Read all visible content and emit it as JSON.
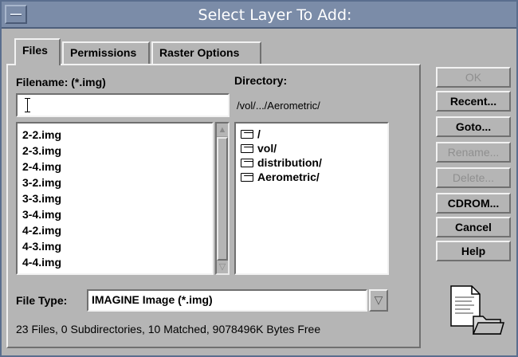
{
  "window": {
    "title": "Select Layer To Add:"
  },
  "tabs": [
    {
      "label": "Files",
      "active": true
    },
    {
      "label": "Permissions",
      "active": false
    },
    {
      "label": "Raster Options",
      "active": false
    }
  ],
  "filename": {
    "label": "Filename: (*.img)",
    "value": ""
  },
  "directory": {
    "label": "Directory:",
    "path": "/vol/.../Aerometric/"
  },
  "files": [
    "2-2.img",
    "2-3.img",
    "2-4.img",
    "3-2.img",
    "3-3.img",
    "3-4.img",
    "4-2.img",
    "4-3.img",
    "4-4.img"
  ],
  "directories": [
    "/",
    "vol/",
    "distribution/",
    "Aerometric/"
  ],
  "file_type": {
    "label": "File Type:",
    "value": "IMAGINE Image (*.img)"
  },
  "status": "23 Files, 0 Subdirectories, 10 Matched, 9078496K Bytes Free",
  "buttons": {
    "ok": "OK",
    "recent": "Recent...",
    "goto": "Goto...",
    "rename": "Rename...",
    "delete": "Delete...",
    "cdrom": "CDROM...",
    "cancel": "Cancel",
    "help": "Help"
  },
  "icons": {
    "menu": "window-menu-icon",
    "folder": "folder-icon",
    "document": "document-folder-icon"
  },
  "colors": {
    "titlebar": "#7b8ca8",
    "background": "#b5b5b5"
  }
}
